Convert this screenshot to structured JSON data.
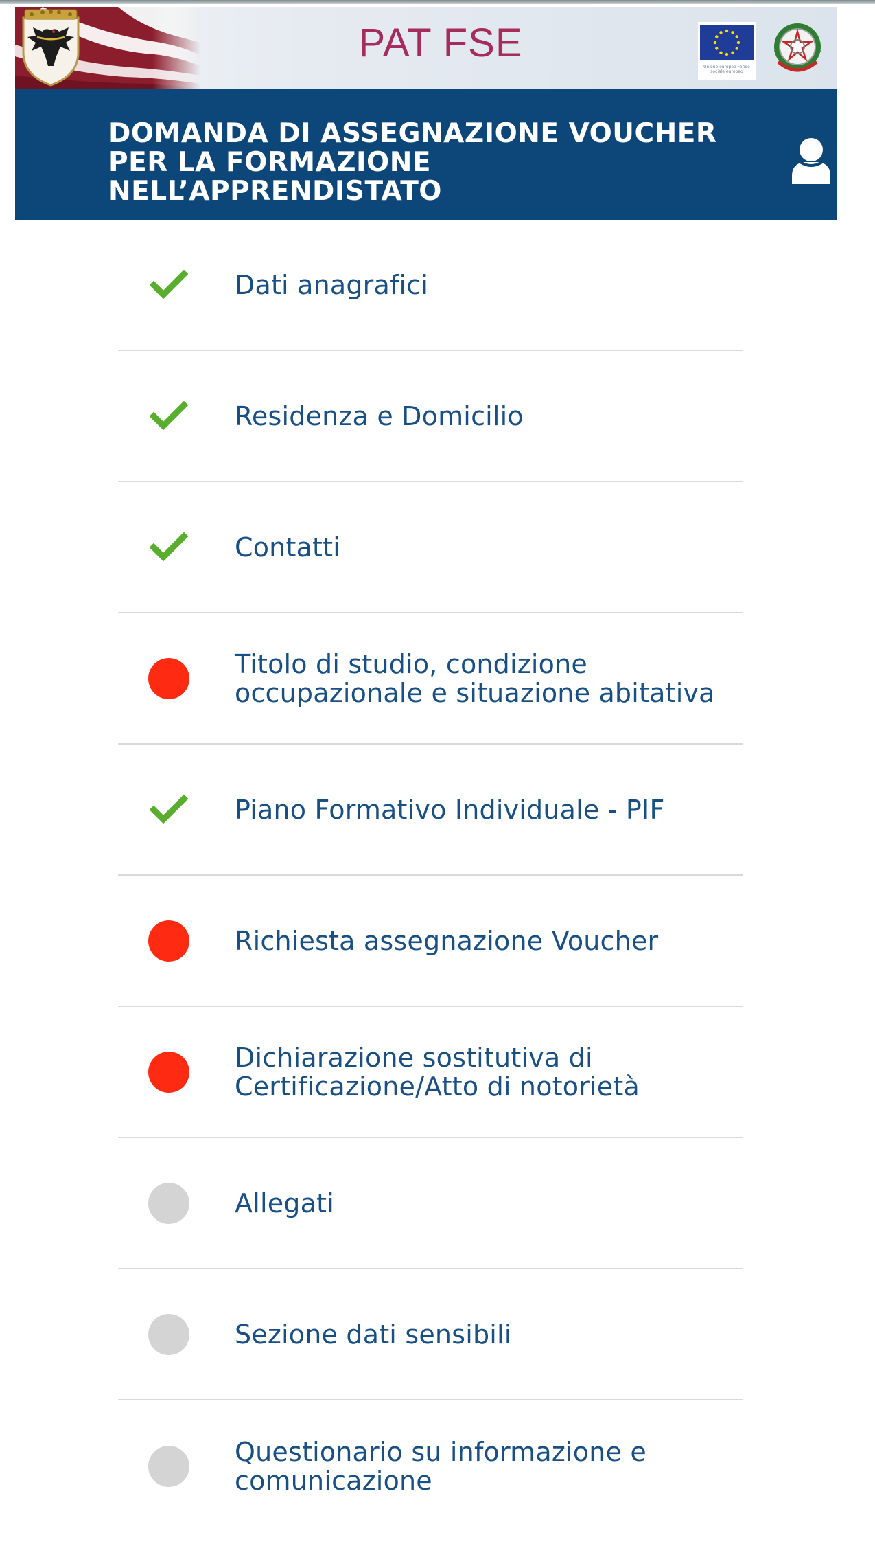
{
  "app": {
    "banner_title": "PAT FSE",
    "eu_caption": "Unione europea Fondo sociale europeo"
  },
  "header": {
    "title_lines": [
      "DOMANDA DI ASSEGNAZIONE VOUCHER",
      "PER LA FORMAZIONE",
      "NELL’APPRENDISTATO"
    ]
  },
  "colors": {
    "header_bg": "#0d4678",
    "banner_title": "#a62c5c",
    "link_text": "#184f85",
    "status_complete": "#5aae2e",
    "status_error": "#ff2a12",
    "status_pending": "#d4d4d4"
  },
  "steps": [
    {
      "status": "complete",
      "icon": "check-icon",
      "lines": [
        "Dati anagrafici"
      ]
    },
    {
      "status": "complete",
      "icon": "check-icon",
      "lines": [
        "Residenza e Domicilio"
      ]
    },
    {
      "status": "complete",
      "icon": "check-icon",
      "lines": [
        "Contatti"
      ]
    },
    {
      "status": "error",
      "icon": "red-dot-icon",
      "lines": [
        "Titolo di studio, condizione",
        "occupazionale e situazione abitativa"
      ]
    },
    {
      "status": "complete",
      "icon": "check-icon",
      "lines": [
        "Piano Formativo Individuale - PIF"
      ]
    },
    {
      "status": "error",
      "icon": "red-dot-icon",
      "lines": [
        "Richiesta assegnazione Voucher"
      ]
    },
    {
      "status": "error",
      "icon": "red-dot-icon",
      "lines": [
        "Dichiarazione sostitutiva di",
        "Certificazione/Atto di notorietà"
      ]
    },
    {
      "status": "pending",
      "icon": "grey-dot-icon",
      "lines": [
        "Allegati"
      ]
    },
    {
      "status": "pending",
      "icon": "grey-dot-icon",
      "lines": [
        "Sezione dati sensibili"
      ]
    },
    {
      "status": "pending",
      "icon": "grey-dot-icon",
      "lines": [
        "Questionario su informazione e",
        "comunicazione"
      ]
    }
  ]
}
